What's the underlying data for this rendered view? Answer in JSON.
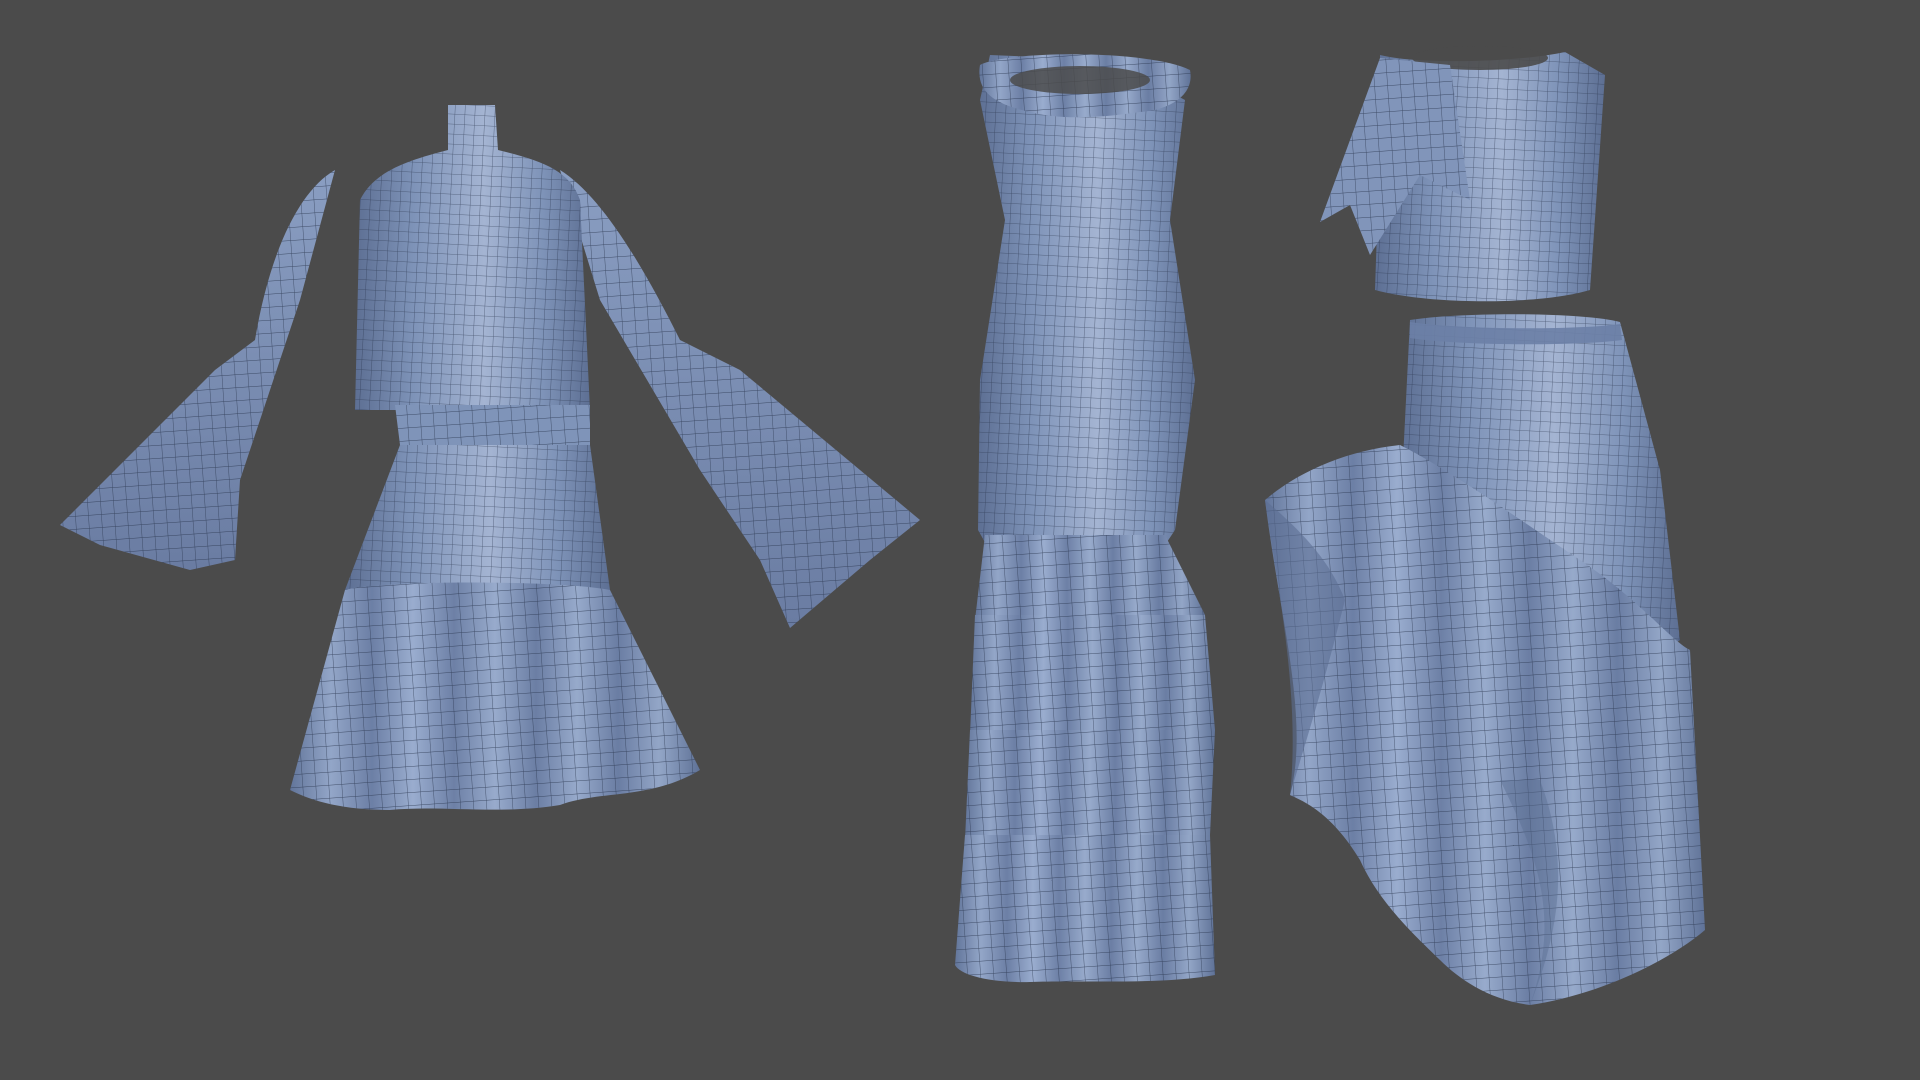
{
  "scene": {
    "background_color": "#4b4b4b",
    "fabric_color": "#7e93b8",
    "fabric_shadow_color": "#5d6f93",
    "fabric_highlight_color": "#a4b4d2",
    "mesh_line_color": "#27324a",
    "garments": [
      {
        "name": "bell-sleeve-mock-neck-dress-with-belt-and-ruffle-hem"
      },
      {
        "name": "sleeveless-tiered-ruffle-maxi-dress"
      },
      {
        "name": "draped-crop-top"
      },
      {
        "name": "asymmetric-ruffle-midi-skirt"
      }
    ]
  }
}
